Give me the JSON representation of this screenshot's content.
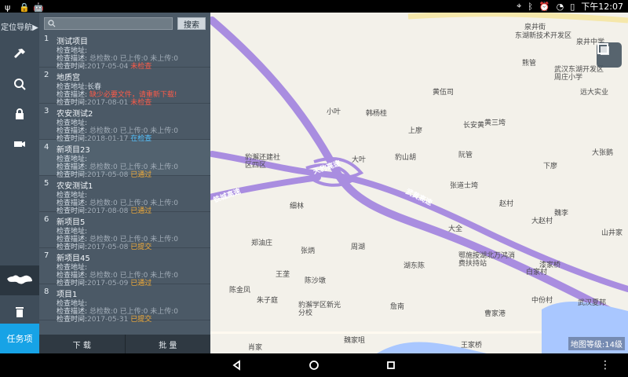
{
  "status": {
    "time": "下午12:07"
  },
  "rail": {
    "nav_title": "定位导航▶",
    "task_label": "任务项"
  },
  "search": {
    "placeholder": "",
    "button": "搜索"
  },
  "tasks": [
    {
      "index": "1",
      "title": "测试项目",
      "address_label": "检查地址:",
      "address_value": "",
      "desc_label": "检查描述:",
      "desc_parts": [
        "总检数:0",
        "已上传:0",
        "未上传:0"
      ],
      "time_label": "检查时间:",
      "time_value": "2017-05-04",
      "status": "未检查"
    },
    {
      "index": "2",
      "title": "地质宫",
      "address_label": "检查地址:",
      "address_value": "长春",
      "desc_label": "检查描述:",
      "desc_parts": [
        "缺少必要文件，请重新下载!"
      ],
      "time_label": "检查时间:",
      "time_value": "2017-08-01",
      "status": "未检查"
    },
    {
      "index": "3",
      "title": "农安测试2",
      "address_label": "检查地址:",
      "address_value": "",
      "desc_label": "检查描述:",
      "desc_parts": [
        "总检数:0",
        "已上传:0",
        "未上传:0"
      ],
      "time_label": "检查时间:",
      "time_value": "2018-01-17",
      "status": "在检查"
    },
    {
      "index": "4",
      "title": "新项目23",
      "address_label": "检查地址:",
      "address_value": "",
      "desc_label": "检查描述:",
      "desc_parts": [
        "总检数:0",
        "已上传:0",
        "未上传:0"
      ],
      "time_label": "检查时间:",
      "time_value": "2017-05-08",
      "status": "已通过"
    },
    {
      "index": "5",
      "title": "农安测试1",
      "address_label": "检查地址:",
      "address_value": "",
      "desc_label": "检查描述:",
      "desc_parts": [
        "总检数:0",
        "已上传:0",
        "未上传:0"
      ],
      "time_label": "检查时间:",
      "time_value": "2017-08-08",
      "status": "已通过"
    },
    {
      "index": "6",
      "title": "新项目5",
      "address_label": "检查地址:",
      "address_value": "",
      "desc_label": "检查描述:",
      "desc_parts": [
        "总检数:0",
        "已上传:0",
        "未上传:0"
      ],
      "time_label": "检查时间:",
      "time_value": "2017-05-08",
      "status": "已提交"
    },
    {
      "index": "7",
      "title": "新项目45",
      "address_label": "检查地址:",
      "address_value": "",
      "desc_label": "检查描述:",
      "desc_parts": [
        "总检数:0",
        "已上传:0",
        "未上传:0"
      ],
      "time_label": "检查时间:",
      "time_value": "2017-05-09",
      "status": "已通过"
    },
    {
      "index": "8",
      "title": "项目1",
      "address_label": "检查地址:",
      "address_value": "",
      "desc_label": "检查描述:",
      "desc_parts": [
        "总检数:0",
        "已上传:0",
        "未上传:0"
      ],
      "time_label": "检查时间:",
      "time_value": "2017-05-31",
      "status": "已提交"
    }
  ],
  "bottom_actions": {
    "download": "下 载",
    "batch": "批 量"
  },
  "map": {
    "labels": [
      "泉井街",
      "东湖新技术开发区",
      "泉井中学",
      "熊管",
      "武汉东湖开发区",
      "周庄小学",
      "远大实业",
      "黄伍司",
      "小叶",
      "韩杨桂",
      "上廖",
      "长安黄",
      "黄三垮",
      "大叶",
      "豹山胡",
      "阮管",
      "大张鹅",
      "下廖",
      "张道士垮",
      "赵村",
      "大赵村",
      "魏李",
      "山井家",
      "豹澥还建社区四区",
      "细林",
      "大全",
      "鄂施按湖北万鸿消费扶持站",
      "郑油庄",
      "张炳",
      "周湖",
      "湖东陈",
      "漆家桥",
      "白家村",
      "王垄",
      "陈沙墩",
      "陈金凤",
      "朱子庭",
      "豹澥学区新光分校",
      "詹南",
      "中份村",
      "武汉夏邦",
      "曹家港",
      "肖家",
      "魏家咀",
      "王家桥",
      "天豹高速",
      "武黄高速",
      "铁城高速"
    ],
    "zoom_text": "地图等级:14级"
  },
  "colors": {
    "accent_blue": "#17a3e6",
    "panel_bg": "#4b5966",
    "rail_bg": "#3f4d5a",
    "road_purple": "#a98de0",
    "status_red": "#ff5b48",
    "status_orange": "#f7ad35",
    "status_blue": "#52c2ff"
  }
}
